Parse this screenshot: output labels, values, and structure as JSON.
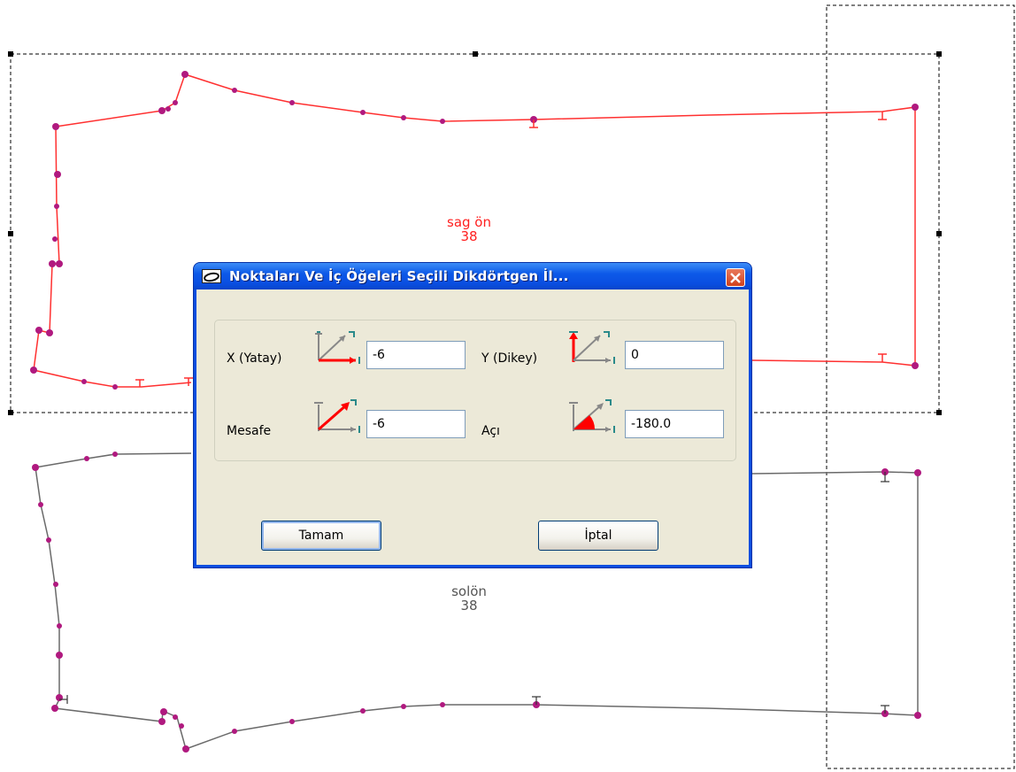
{
  "canvas": {
    "piece_top_name": "sag ön",
    "piece_top_size": "38",
    "piece_bottom_name": "solön",
    "piece_bottom_size": "38"
  },
  "dialog": {
    "title": "Noktaları Ve İç Öğeleri Seçili Dikdörtgen İl...",
    "x_label": "X (Yatay)",
    "x_value": "-6",
    "y_label": "Y (Dikey)",
    "y_value": "0",
    "distance_label": "Mesafe",
    "distance_value": "-6",
    "angle_label": "Açı",
    "angle_value": "-180.0",
    "ok_label": "Tamam",
    "cancel_label": "İptal"
  },
  "colors": {
    "top_piece_outline": "#ff3030",
    "bottom_piece_outline": "#6a6a6a",
    "point_marker": "#b0197f",
    "selection_frame": "#000000",
    "titlebar": "#0a4ee0",
    "dialog_face": "#ece9d8"
  },
  "icons": [
    "x-axis-icon",
    "y-axis-icon",
    "distance-icon",
    "angle-icon",
    "close-icon",
    "app-icon"
  ]
}
